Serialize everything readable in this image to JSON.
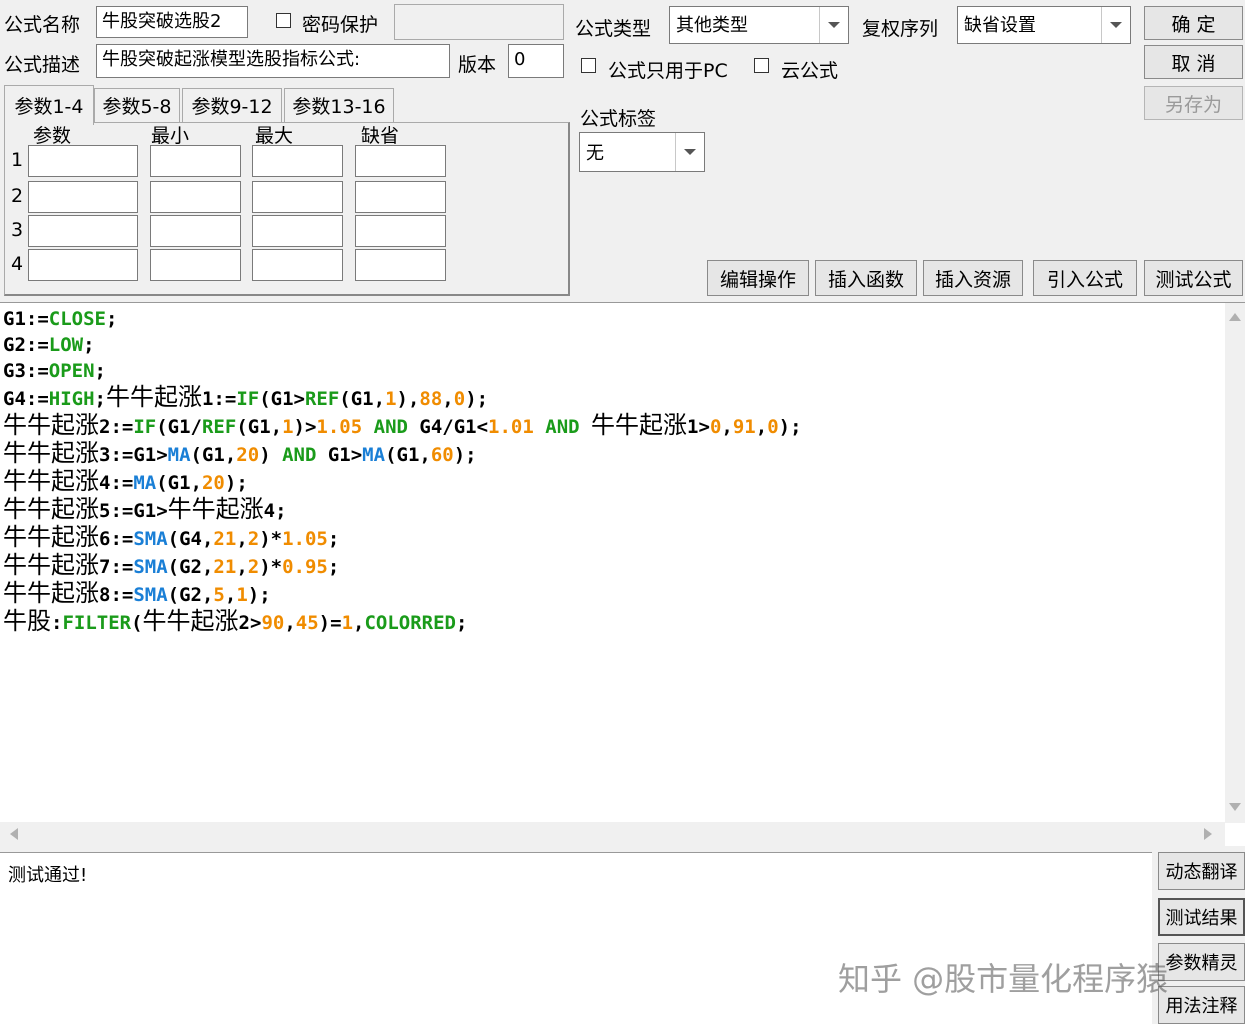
{
  "header": {
    "name_label": "公式名称",
    "name_value": "牛股突破选股2",
    "password_label": "密码保护",
    "desc_label": "公式描述",
    "desc_value": "牛股突破起涨模型选股指标公式:",
    "version_label": "版本",
    "version_value": "0",
    "type_label": "公式类型",
    "type_value": "其他类型",
    "rights_label": "复权序列",
    "rights_value": "缺省设置",
    "pc_only_label": "公式只用于PC",
    "cloud_label": "云公式",
    "tag_label": "公式标签",
    "tag_value": "无"
  },
  "buttons": {
    "ok": "确 定",
    "cancel": "取 消",
    "save_as": "另存为",
    "edit_ops": "编辑操作",
    "insert_func": "插入函数",
    "insert_res": "插入资源",
    "import_formula": "引入公式",
    "test_formula": "测试公式"
  },
  "tabs": [
    "参数1-4",
    "参数5-8",
    "参数9-12",
    "参数13-16"
  ],
  "params": {
    "col_param": "参数",
    "col_min": "最小",
    "col_max": "最大",
    "col_default": "缺省",
    "rows": [
      "1",
      "2",
      "3",
      "4"
    ]
  },
  "output": {
    "text": "测试通过!"
  },
  "side_buttons": [
    "动态翻译",
    "测试结果",
    "参数精灵",
    "用法注释"
  ],
  "watermark": "知乎 @股市量化程序猿"
}
